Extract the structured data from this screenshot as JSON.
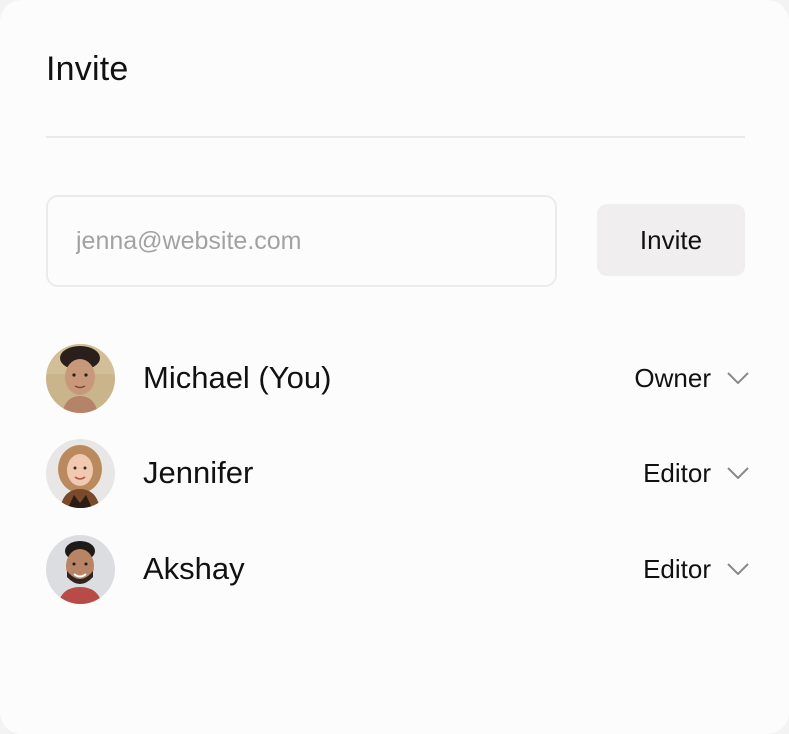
{
  "dialog": {
    "title": "Invite"
  },
  "invite_form": {
    "email_value": "",
    "email_placeholder": "jenna@website.com",
    "button_label": "Invite"
  },
  "members": [
    {
      "name": "Michael (You)",
      "role": "Owner",
      "avatar_icon": "avatar-photo"
    },
    {
      "name": "Jennifer",
      "role": "Editor",
      "avatar_icon": "avatar-photo"
    },
    {
      "name": "Akshay",
      "role": "Editor",
      "avatar_icon": "avatar-photo"
    }
  ],
  "colors": {
    "card_background": "#fdfcfd",
    "button_background": "#f0eeee",
    "divider": "#ebeaeb",
    "placeholder_text": "#a3a2a3"
  }
}
